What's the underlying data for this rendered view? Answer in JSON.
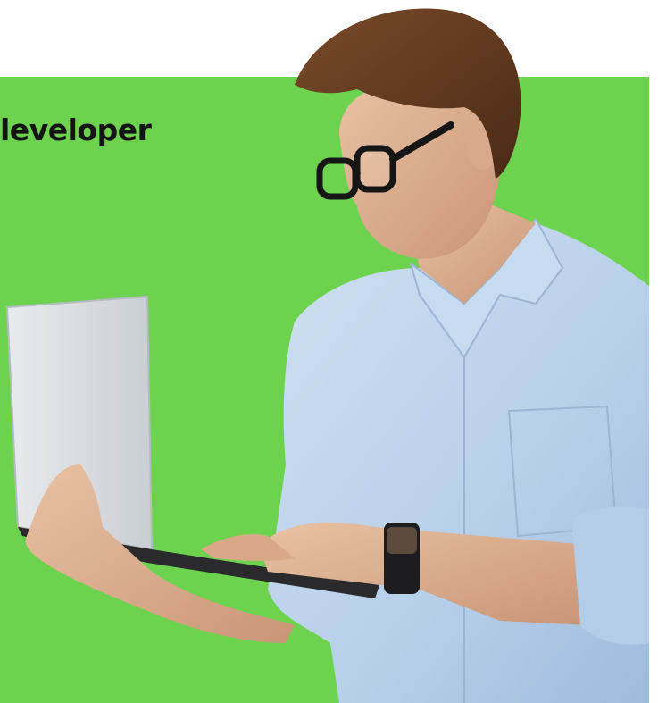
{
  "banner": {
    "heading": "leveloper",
    "background_color": "#6dd34f",
    "page_background": "#ffffff"
  },
  "photo": {
    "subject": "man-with-laptop",
    "shirt_color": "#b9d2ec",
    "laptop_color": "#d9dde1"
  }
}
